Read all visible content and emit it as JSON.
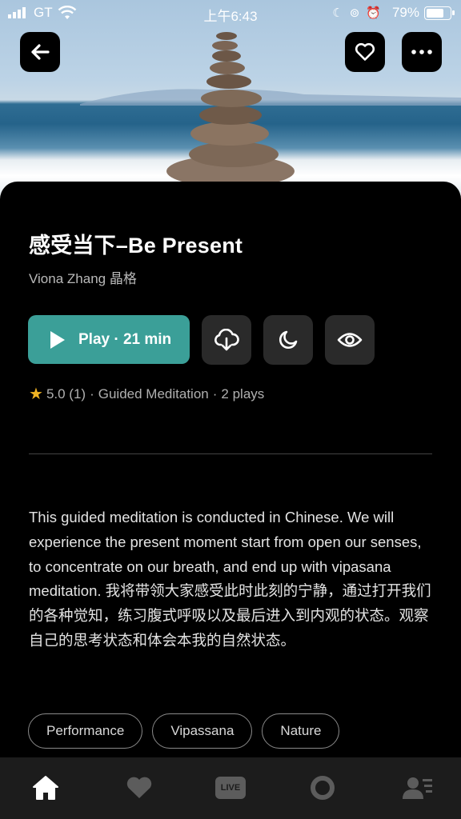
{
  "status_bar": {
    "carrier": "GT",
    "time": "上午6:43",
    "battery": "79%"
  },
  "header": {
    "back_icon": "back-arrow-icon",
    "favorite_icon": "heart-outline-icon",
    "more_icon": "more-dots-icon"
  },
  "track": {
    "title": "感受当下–Be Present",
    "author": "Viona Zhang 晶格",
    "play_label": "Play · 21 min",
    "rating": "5.0 (1)",
    "type": "Guided Meditation",
    "plays": "2 plays",
    "description": "This guided meditation is conducted in Chinese. We will experience the present moment start from open our senses, to concentrate on our breath, and end up with vipasana meditation. 我将带领大家感受此时此刻的宁静，通过打开我们的各种觉知，练习腹式呼吸以及最后进入到内观的状态。观察自己的思考状态和体会本我的自然状态。",
    "tags": [
      "Performance",
      "Vipassana",
      "Nature"
    ]
  },
  "actions": {
    "download_icon": "cloud-download-icon",
    "sleep_icon": "moon-icon",
    "view_icon": "eye-icon"
  },
  "tabbar": {
    "live_label": "LIVE",
    "icons": [
      "home-icon",
      "heart-icon",
      "live-icon",
      "meditate-circle-icon",
      "profile-icon"
    ]
  },
  "colors": {
    "accent": "#3b9f98",
    "star": "#f0b323",
    "background": "#000000"
  }
}
